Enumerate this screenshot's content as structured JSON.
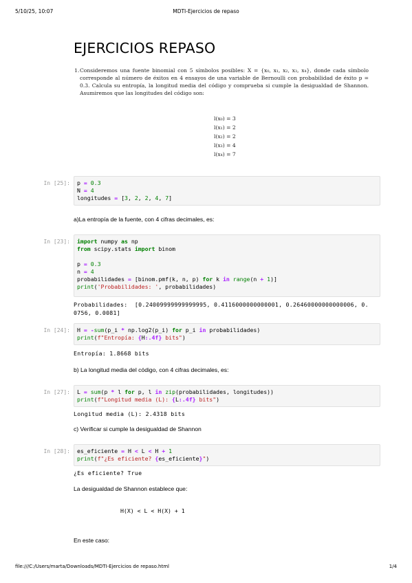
{
  "print_header": {
    "timestamp": "5/10/25, 10:07",
    "page_title": "MDTI-Ejercicios de repaso"
  },
  "print_footer": {
    "url": "file:///C:/Users/marta/Downloads/MDTI-Ejercicios de repaso.html",
    "page": "1/4"
  },
  "notebook": {
    "title": "EJERCICIOS REPASO",
    "exercise": {
      "number": "1.",
      "text": "Consideremos una fuente binomial con 5 símbolos posibles: X = {x₀, x₁, x₂, x₃, x₄}, donde cada símbolo corresponde al número de éxitos en 4 ensayos de una variable de Bernoulli con probabilidad de éxito p = 0.3. Calcula su entropía, la longitud media del código y comprueba si cumple la desigualdad de Shannon. Asumiremos que las longitudes del código son:",
      "lengths": [
        "l(x₀) = 3",
        "l(x₁) = 2",
        "l(x₂) = 2",
        "l(x₃) = 4",
        "l(x₄) = 7"
      ]
    },
    "cells": [
      {
        "prompt": "In [25]:",
        "lines": [
          "p = 0.3",
          "N = 4",
          "longitudes = [3, 2, 2, 4, 7]"
        ]
      },
      {
        "prompt": "In [23]:",
        "lines": [
          "import numpy as np",
          "from scipy.stats import binom",
          "",
          "p = 0.3",
          "n = 4",
          "probabilidades = [binom.pmf(k, n, p) for k in range(n + 1)]",
          "print('Probabilidades: ', probabilidades)"
        ],
        "output": "Probabilidades:  [0.24009999999999995, 0.4116000000000001, 0.26460000000000006, 0.\n0756, 0.0081]"
      },
      {
        "prompt": "In [24]:",
        "lines": [
          "H = -sum(p_i * np.log2(p_i) for p_i in probabilidades)",
          "print(f\"Entropía: {H:.4f} bits\")"
        ],
        "output": "Entropía: 1.8668 bits"
      },
      {
        "prompt": "In [27]:",
        "lines": [
          "L = sum(p * l for p, l in zip(probabilidades, longitudes))",
          "print(f\"Longitud media (L): {L:.4f} bits\")"
        ],
        "output": "Longitud media (L): 2.4318 bits"
      },
      {
        "prompt": "In [28]:",
        "lines": [
          "es_eficiente = H < L < H + 1",
          "print(f\"¿Es eficiente? {es_eficiente}\")"
        ],
        "output": "¿Es eficiente? True"
      }
    ],
    "markdown": {
      "a": "a)La entropía de la fuente, con 4 cifras decimales, es:",
      "b": "b) La longitud media del código, con 4 cifras decimales, es:",
      "c": "c) Verificar si cumple la desigualdad de Shannon",
      "shannon_intro": "La desigualdad de Shannon establece que:",
      "shannon_formula": "H(X) < L < H(X) + 1",
      "en_este_caso": "En este caso:"
    }
  }
}
